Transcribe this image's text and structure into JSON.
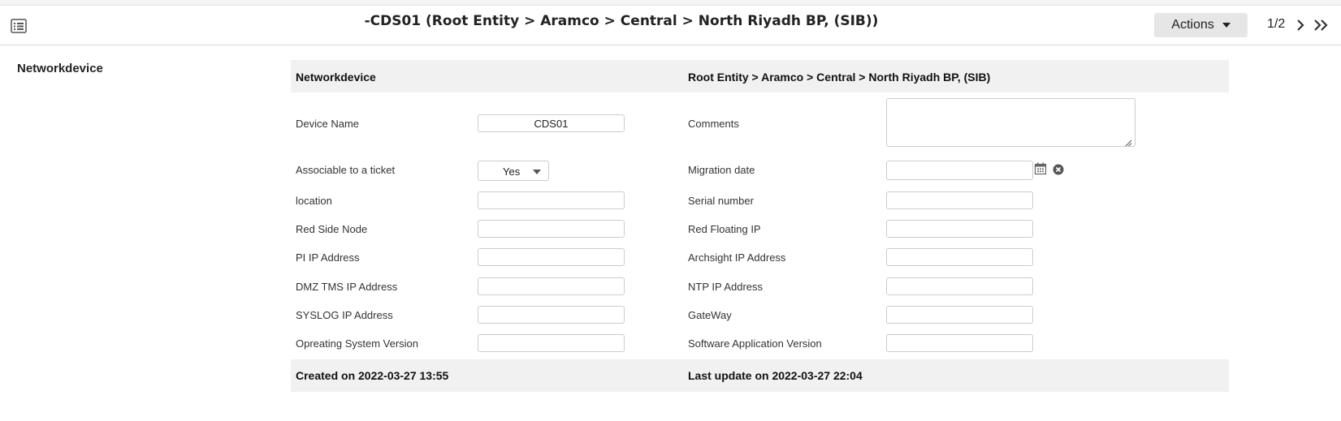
{
  "header": {
    "title": "-CDS01 (Root Entity > Aramco > Central > North Riyadh BP, (SIB))",
    "actions_label": "Actions",
    "pager": "1/2",
    "icons": {
      "menu": "list-icon",
      "next": "chevron-right-icon",
      "last": "double-chevron-right-icon"
    }
  },
  "section": {
    "title": "Networkdevice"
  },
  "form": {
    "header_left": "Networkdevice",
    "header_right": "Root Entity > Aramco > Central > North Riyadh BP, (SIB)",
    "device_name": {
      "label": "Device Name",
      "value": "CDS01"
    },
    "comments": {
      "label": "Comments",
      "value": ""
    },
    "associable": {
      "label": "Associable to a ticket",
      "value": "Yes"
    },
    "migration_date": {
      "label": "Migration date",
      "value": ""
    },
    "location": {
      "label": "location",
      "value": ""
    },
    "serial_number": {
      "label": "Serial number",
      "value": ""
    },
    "red_side_node": {
      "label": "Red Side Node",
      "value": ""
    },
    "red_floating_ip": {
      "label": "Red Floating IP",
      "value": ""
    },
    "pi_ip": {
      "label": "PI IP Address",
      "value": ""
    },
    "archsight_ip": {
      "label": "Archsight IP Address",
      "value": ""
    },
    "dmz_tms_ip": {
      "label": "DMZ TMS IP Address",
      "value": ""
    },
    "ntp_ip": {
      "label": "NTP IP Address",
      "value": ""
    },
    "syslog_ip": {
      "label": "SYSLOG IP Address",
      "value": ""
    },
    "gateway": {
      "label": "GateWay",
      "value": ""
    },
    "os_version": {
      "label": "Opreating System Version",
      "value": ""
    },
    "software_version": {
      "label": "Software Application Version",
      "value": ""
    },
    "footer_left": "Created on 2022-03-27 13:55",
    "footer_right": "Last update on 2022-03-27 22:04"
  }
}
